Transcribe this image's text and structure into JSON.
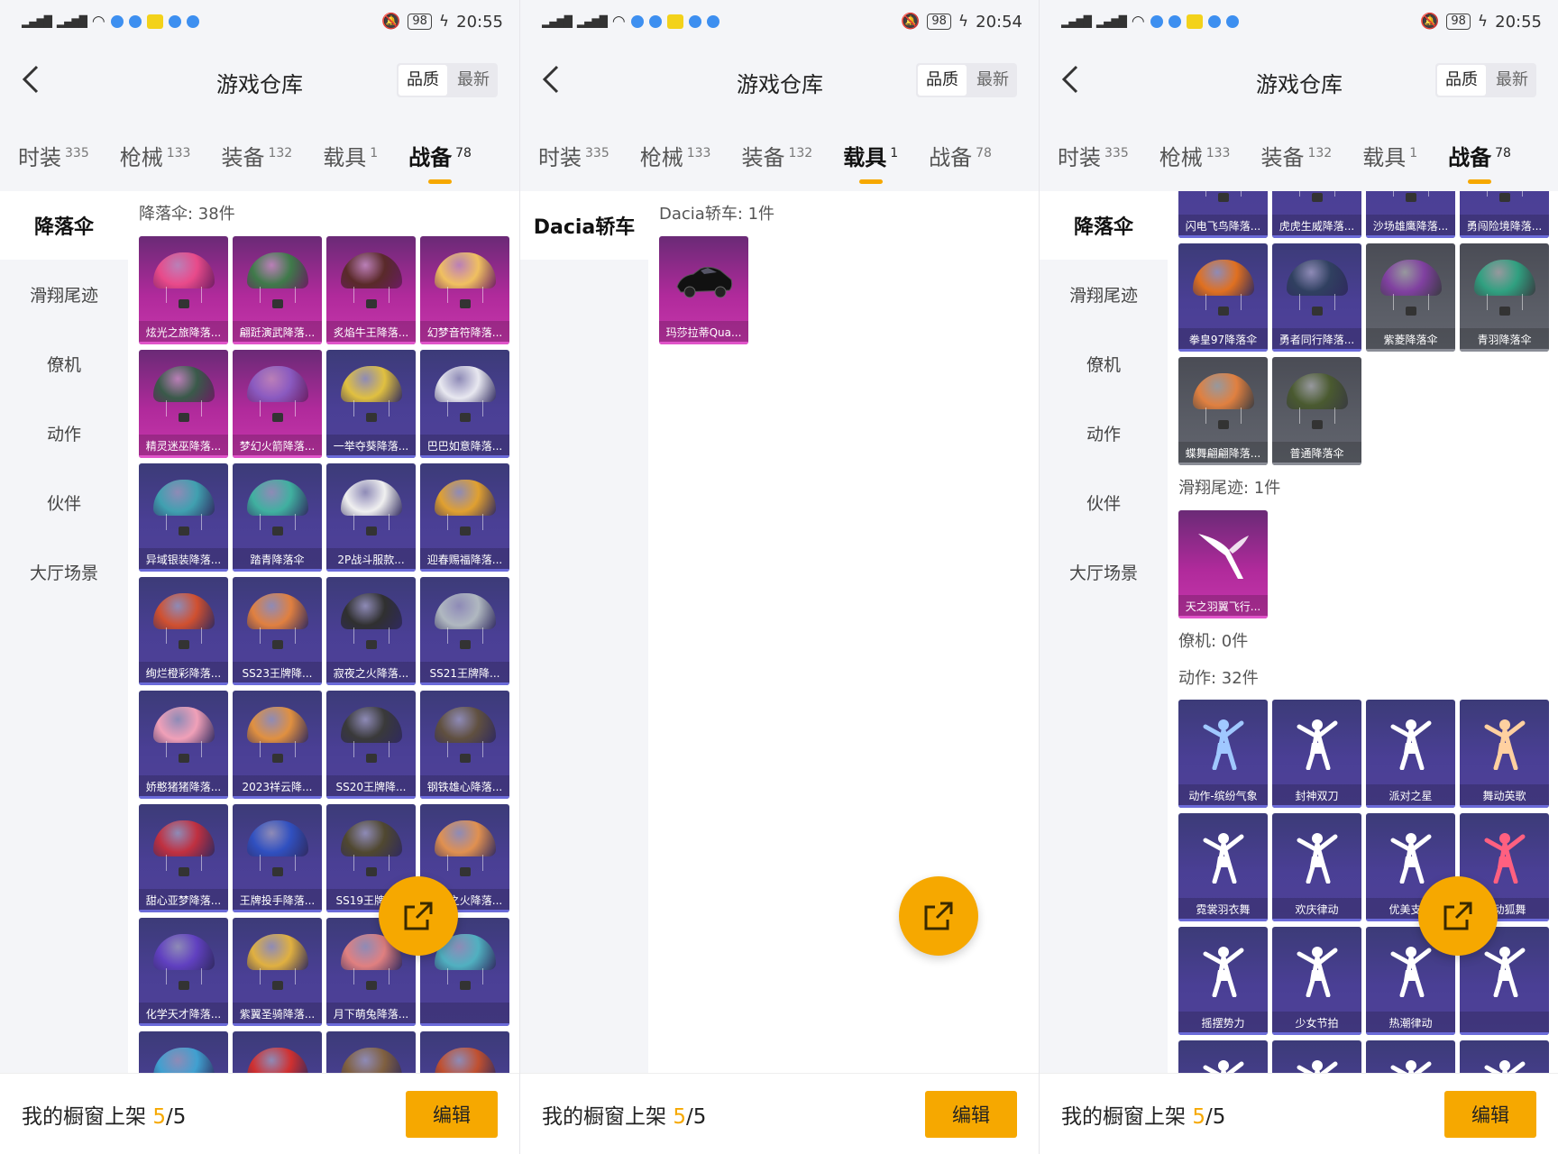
{
  "screens": [
    {
      "status": {
        "time": "20:55",
        "battery": "98"
      },
      "header": {
        "back_icon": "chevron-left-icon",
        "title": "游戏仓库",
        "sort_quality": "品质",
        "sort_latest": "最新"
      },
      "tabs": [
        {
          "label": "时装",
          "count": "335",
          "active": false
        },
        {
          "label": "枪械",
          "count": "133",
          "active": false
        },
        {
          "label": "装备",
          "count": "132",
          "active": false
        },
        {
          "label": "载具",
          "count": "1",
          "active": false
        },
        {
          "label": "战备",
          "count": "78",
          "active": true
        }
      ],
      "side": [
        "降落伞",
        "滑翔尾迹",
        "僚机",
        "动作",
        "伙伴",
        "大厅场景"
      ],
      "side_active": 0,
      "content": {
        "section_title": "降落伞: 38件",
        "items": [
          {
            "name": "炫光之旅降落...",
            "quality": "pink",
            "color": "#e84a8a"
          },
          {
            "name": "翩跹演武降落...",
            "quality": "pink",
            "color": "#3f7a4a"
          },
          {
            "name": "炙焰牛王降落...",
            "quality": "pink",
            "color": "#5a2a2a"
          },
          {
            "name": "幻梦音符降落...",
            "quality": "pink",
            "color": "#f0c060"
          },
          {
            "name": "精灵迷巫降落...",
            "quality": "pink",
            "color": "#3a5a4a"
          },
          {
            "name": "梦幻火箭降落...",
            "quality": "pink",
            "color": "#8a5ac0"
          },
          {
            "name": "一举夺葵降落...",
            "quality": "purple",
            "color": "#e0c040"
          },
          {
            "name": "巴巴如意降落...",
            "quality": "purple",
            "color": "#e8e8f0"
          },
          {
            "name": "异域银装降落...",
            "quality": "purple",
            "color": "#40a0b0"
          },
          {
            "name": "踏青降落伞",
            "quality": "purple",
            "color": "#40b0a0"
          },
          {
            "name": "2P战斗服款...",
            "quality": "purple",
            "color": "#f0f0f0"
          },
          {
            "name": "迎春赐福降落...",
            "quality": "purple",
            "color": "#e0a030"
          },
          {
            "name": "绚烂橙彩降落...",
            "quality": "purple",
            "color": "#d05030"
          },
          {
            "name": "SS23王牌降...",
            "quality": "purple",
            "color": "#e08040"
          },
          {
            "name": "寂夜之火降落...",
            "quality": "purple",
            "color": "#303030"
          },
          {
            "name": "SS21王牌降...",
            "quality": "purple",
            "color": "#b0b8c0"
          },
          {
            "name": "娇憨猪猪降落...",
            "quality": "purple",
            "color": "#f0a0b8"
          },
          {
            "name": "2023祥云降...",
            "quality": "purple",
            "color": "#e09040"
          },
          {
            "name": "SS20王牌降...",
            "quality": "purple",
            "color": "#3a3a3a"
          },
          {
            "name": "钢铁雄心降落...",
            "quality": "purple",
            "color": "#605040"
          },
          {
            "name": "甜心亚梦降落...",
            "quality": "purple",
            "color": "#c03040"
          },
          {
            "name": "王牌投手降落...",
            "quality": "purple",
            "color": "#3050c0"
          },
          {
            "name": "SS19王牌降...",
            "quality": "purple",
            "color": "#504830"
          },
          {
            "name": "白昼之火降落...",
            "quality": "purple",
            "color": "#e09050"
          },
          {
            "name": "化学天才降落...",
            "quality": "purple",
            "color": "#6040c0"
          },
          {
            "name": "紫翼圣骑降落...",
            "quality": "purple",
            "color": "#e0b040"
          },
          {
            "name": "月下萌兔降落...",
            "quality": "purple",
            "color": "#e08080"
          },
          {
            "name": "",
            "quality": "purple",
            "color": "#50b0c0"
          },
          {
            "name": "",
            "quality": "purple",
            "color": "#40a0d0"
          },
          {
            "name": "",
            "quality": "purple",
            "color": "#d03030"
          },
          {
            "name": "",
            "quality": "purple",
            "color": "#806040"
          },
          {
            "name": "",
            "quality": "purple",
            "color": "#c05030"
          }
        ]
      },
      "bottom": {
        "label": "我的橱窗上架 ",
        "count": "5",
        "total": "/5",
        "edit_label": "编辑"
      }
    },
    {
      "status": {
        "time": "20:54",
        "battery": "98"
      },
      "header": {
        "back_icon": "chevron-left-icon",
        "title": "游戏仓库",
        "sort_quality": "品质",
        "sort_latest": "最新"
      },
      "tabs": [
        {
          "label": "时装",
          "count": "335",
          "active": false
        },
        {
          "label": "枪械",
          "count": "133",
          "active": false
        },
        {
          "label": "装备",
          "count": "132",
          "active": false
        },
        {
          "label": "载具",
          "count": "1",
          "active": true
        },
        {
          "label": "战备",
          "count": "78",
          "active": false
        }
      ],
      "side": [
        "Dacia轿车"
      ],
      "side_active": 0,
      "content": {
        "section_title": "Dacia轿车: 1件",
        "items": [
          {
            "name": "玛莎拉蒂Qua...",
            "quality": "pink",
            "color": "#111111",
            "kind": "car"
          }
        ]
      },
      "bottom": {
        "label": "我的橱窗上架 ",
        "count": "5",
        "total": "/5",
        "edit_label": "编辑"
      }
    },
    {
      "status": {
        "time": "20:55",
        "battery": "98"
      },
      "header": {
        "back_icon": "chevron-left-icon",
        "title": "游戏仓库",
        "sort_quality": "品质",
        "sort_latest": "最新"
      },
      "tabs": [
        {
          "label": "时装",
          "count": "335",
          "active": false
        },
        {
          "label": "枪械",
          "count": "133",
          "active": false
        },
        {
          "label": "装备",
          "count": "132",
          "active": false
        },
        {
          "label": "载具",
          "count": "1",
          "active": false
        },
        {
          "label": "战备",
          "count": "78",
          "active": true
        }
      ],
      "side": [
        "降落伞",
        "滑翔尾迹",
        "僚机",
        "动作",
        "伙伴",
        "大厅场景"
      ],
      "side_active": 0,
      "content": {
        "top_items": [
          {
            "name": "闪电飞鸟降落...",
            "quality": "purple",
            "color": "#4060c0"
          },
          {
            "name": "虎虎生威降落...",
            "quality": "purple",
            "color": "#e08030"
          },
          {
            "name": "沙场雄鹰降落...",
            "quality": "purple",
            "color": "#806040"
          },
          {
            "name": "勇闯险境降落...",
            "quality": "purple",
            "color": "#30a060"
          },
          {
            "name": "拳皇97降落伞",
            "quality": "purple",
            "color": "#e07020"
          },
          {
            "name": "勇者同行降落...",
            "quality": "purple",
            "color": "#304060"
          },
          {
            "name": "紫菱降落伞",
            "quality": "grey",
            "color": "#8040a0"
          },
          {
            "name": "青羽降落伞",
            "quality": "grey",
            "color": "#30a080"
          },
          {
            "name": "蝶舞翩翩降落...",
            "quality": "grey",
            "color": "#e08040"
          },
          {
            "name": "普通降落伞",
            "quality": "grey",
            "color": "#4a5a30"
          }
        ],
        "glide_title": "滑翔尾迹: 1件",
        "glide_items": [
          {
            "name": "天之羽翼飞行...",
            "quality": "pink",
            "color": "#ffffff",
            "kind": "wing"
          }
        ],
        "wingman_title": "僚机: 0件",
        "emote_title": "动作: 32件",
        "emote_items": [
          {
            "name": "动作-缤纷气象",
            "quality": "purple",
            "color": "#a0c8ff",
            "kind": "dancer"
          },
          {
            "name": "封神双刀",
            "quality": "purple",
            "color": "#ffffff",
            "kind": "dancer"
          },
          {
            "name": "派对之星",
            "quality": "purple",
            "color": "#ffffff",
            "kind": "dancer"
          },
          {
            "name": "舞动英歌",
            "quality": "purple",
            "color": "#ffd0a0",
            "kind": "dancer"
          },
          {
            "name": "霓裳羽衣舞",
            "quality": "purple",
            "color": "#ffffff",
            "kind": "dancer"
          },
          {
            "name": "欢庆律动",
            "quality": "purple",
            "color": "#ffffff",
            "kind": "dancer"
          },
          {
            "name": "优美支点",
            "quality": "purple",
            "color": "#ffffff",
            "kind": "dancer"
          },
          {
            "name": "心动狐舞",
            "quality": "purple",
            "color": "#ff6080",
            "kind": "dancer"
          },
          {
            "name": "摇摆势力",
            "quality": "purple",
            "color": "#ffffff",
            "kind": "dancer"
          },
          {
            "name": "少女节拍",
            "quality": "purple",
            "color": "#ffffff",
            "kind": "dancer"
          },
          {
            "name": "热潮律动",
            "quality": "purple",
            "color": "#ffffff",
            "kind": "dancer"
          },
          {
            "name": "",
            "quality": "purple",
            "color": "#ffffff",
            "kind": "dancer"
          },
          {
            "name": "",
            "quality": "purple",
            "color": "#ffffff",
            "kind": "dancer"
          },
          {
            "name": "",
            "quality": "purple",
            "color": "#ffffff",
            "kind": "dancer"
          },
          {
            "name": "",
            "quality": "purple",
            "color": "#ffffff",
            "kind": "dancer"
          },
          {
            "name": "",
            "quality": "purple",
            "color": "#ffffff",
            "kind": "dancer"
          }
        ]
      },
      "bottom": {
        "label": "我的橱窗上架 ",
        "count": "5",
        "total": "/5",
        "edit_label": "编辑"
      }
    }
  ],
  "fab_icon": "share-external-icon",
  "colors": {
    "accent": "#f6a800",
    "card_purple": "#4a3f95",
    "card_pink": "#b02a9b",
    "card_grey": "#5a5d66"
  }
}
